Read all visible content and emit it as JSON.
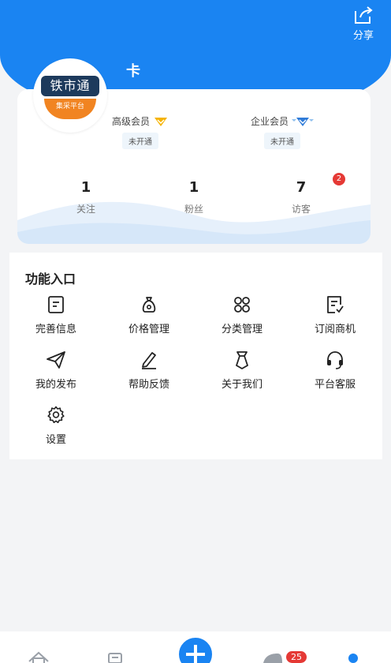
{
  "header": {
    "share_label": "分享",
    "username": "卡"
  },
  "avatar": {
    "logo_text": "铁市通",
    "logo_sub": "集采平台"
  },
  "memberships": [
    {
      "label": "高级会员",
      "status": "未开通",
      "icon": "gold-diamond-icon",
      "color": "#f5b301"
    },
    {
      "label": "企业会员",
      "status": "未开通",
      "icon": "blue-diamond-icon",
      "color": "#2f7bd8"
    }
  ],
  "stats": [
    {
      "value": "1",
      "label": "关注"
    },
    {
      "value": "1",
      "label": "粉丝"
    },
    {
      "value": "7",
      "label": "访客",
      "badge": "2"
    }
  ],
  "functions": {
    "title": "功能入口",
    "items": [
      {
        "label": "完善信息",
        "icon": "document-icon"
      },
      {
        "label": "价格管理",
        "icon": "money-bag-icon"
      },
      {
        "label": "分类管理",
        "icon": "category-grid-icon"
      },
      {
        "label": "订阅商机",
        "icon": "subscribe-check-icon"
      },
      {
        "label": "我的发布",
        "icon": "send-plane-icon"
      },
      {
        "label": "帮助反馈",
        "icon": "edit-pencil-icon"
      },
      {
        "label": "关于我们",
        "icon": "tie-icon"
      },
      {
        "label": "平台客服",
        "icon": "headset-icon"
      },
      {
        "label": "设置",
        "icon": "gear-icon"
      }
    ]
  },
  "bottom_nav": {
    "badge": "25"
  },
  "colors": {
    "primary": "#1a84f2",
    "badge": "#e53935"
  }
}
